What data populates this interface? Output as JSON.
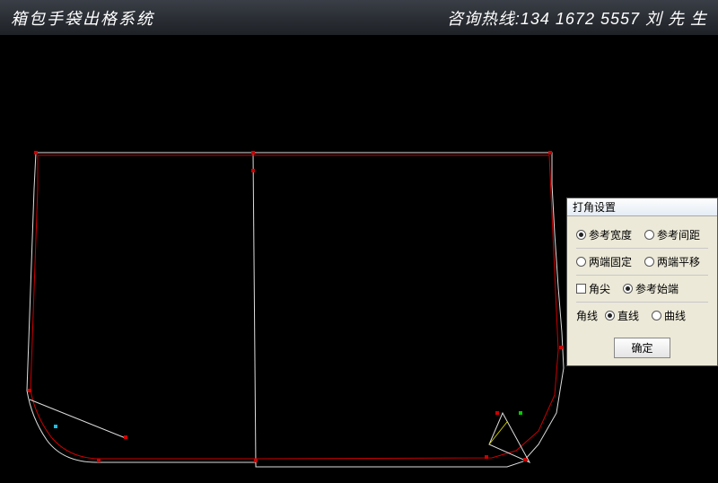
{
  "header": {
    "title": "箱包手袋出格系统",
    "hotline": "咨询热线:134 1672 5557  刘 先 生"
  },
  "dialog": {
    "title": "打角设置",
    "group1": {
      "option_a": "参考宽度",
      "option_b": "参考间距",
      "selected": "a"
    },
    "group2": {
      "option_a": "两端固定",
      "option_b": "两端平移",
      "selected": "a"
    },
    "group3": {
      "sharp_label": "角尖",
      "sharp_checked": false,
      "ref_option": "参考始端",
      "ref_selected": true
    },
    "group4": {
      "label": "角线",
      "option_a": "直线",
      "option_b": "曲线",
      "selected": "a"
    },
    "ok_label": "确定"
  }
}
